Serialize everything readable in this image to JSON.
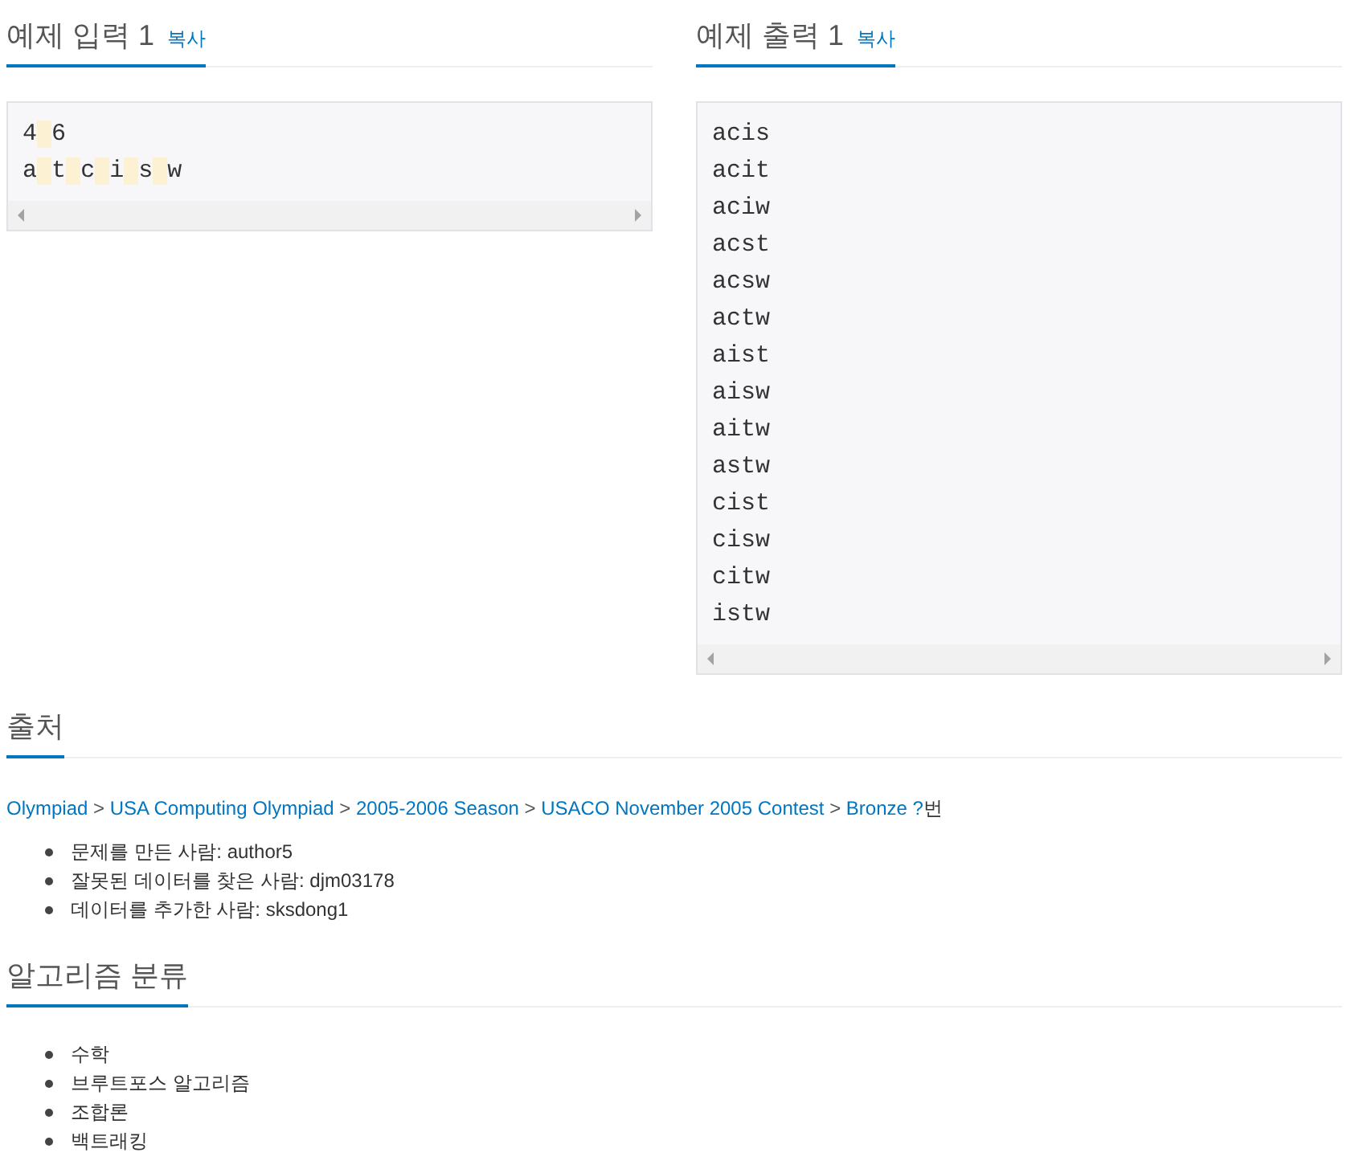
{
  "samples": [
    {
      "title": "예제 입력 1",
      "copy_label": "복사",
      "lines": [
        "4 6",
        "a t c i s w"
      ]
    },
    {
      "title": "예제 출력 1",
      "copy_label": "복사",
      "lines": [
        "acis",
        "acit",
        "aciw",
        "acst",
        "acsw",
        "actw",
        "aist",
        "aisw",
        "aitw",
        "astw",
        "cist",
        "cisw",
        "citw",
        "istw"
      ]
    }
  ],
  "source": {
    "title": "출처",
    "breadcrumb": [
      {
        "kind": "link",
        "text": "Olympiad"
      },
      {
        "kind": "separator",
        "text": ">"
      },
      {
        "kind": "link",
        "text": "USA Computing Olympiad"
      },
      {
        "kind": "separator",
        "text": ">"
      },
      {
        "kind": "link",
        "text": "2005-2006 Season"
      },
      {
        "kind": "separator",
        "text": ">"
      },
      {
        "kind": "link",
        "text": "USACO November 2005 Contest"
      },
      {
        "kind": "separator",
        "text": ">"
      },
      {
        "kind": "link",
        "text": "Bronze ?"
      },
      {
        "kind": "text",
        "text": "번"
      }
    ],
    "credits": [
      "문제를 만든 사람: author5",
      "잘못된 데이터를 찾은 사람: djm03178",
      "데이터를 추가한 사람: sksdong1"
    ]
  },
  "algorithms": {
    "title": "알고리즘 분류",
    "tags": [
      "수학",
      "브루트포스 알고리즘",
      "조합론",
      "백트래킹"
    ]
  }
}
